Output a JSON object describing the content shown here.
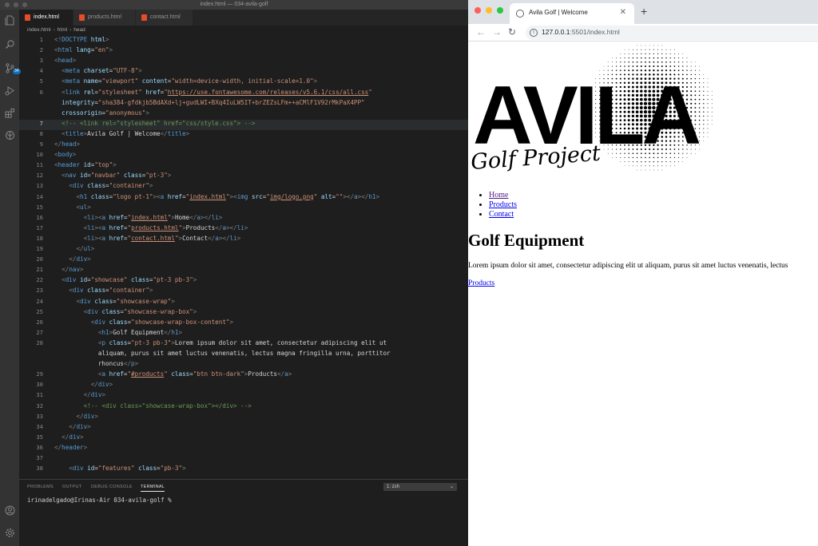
{
  "vscode": {
    "window_title": "index.html — 034-avila-golf",
    "activity_badge": "34",
    "tabs": [
      {
        "label": "index.html",
        "active": true
      },
      {
        "label": "products.html",
        "active": false
      },
      {
        "label": "contact.html",
        "active": false
      }
    ],
    "breadcrumb": [
      "index.html",
      "html",
      "head"
    ],
    "panel": {
      "tabs": [
        "PROBLEMS",
        "OUTPUT",
        "DEBUG CONSOLE",
        "TERMINAL"
      ],
      "active_tab": "TERMINAL",
      "shell": "1: zsh",
      "prompt": "irinadelgado@Irinas-Air 034-avila-golf %"
    },
    "cursor_line": "7"
  },
  "browser": {
    "tab_title": "Avila Golf | Welcome",
    "url_host": "127.0.0.1",
    "url_rest": ":5501/index.html",
    "page": {
      "logo_word": "AVILA",
      "logo_tagline": "Golf Project",
      "nav": [
        "Home",
        "Products",
        "Contact"
      ],
      "heading": "Golf Equipment",
      "paragraph": "Lorem ipsum dolor sit amet, consectetur adipiscing elit ut aliquam, purus sit amet luctus venenatis, lectus",
      "button": "Products"
    }
  },
  "code_lines": [
    {
      "n": "1",
      "t": [
        [
          "pu",
          "<!"
        ],
        [
          "tg",
          "DOCTYPE"
        ],
        [
          "at",
          " html"
        ],
        [
          "pu",
          ">"
        ]
      ]
    },
    {
      "n": "2",
      "t": [
        [
          "pu",
          "<"
        ],
        [
          "tg",
          "html"
        ],
        [
          "at",
          " lang"
        ],
        [
          "tx",
          "="
        ],
        [
          "st",
          "\"en\""
        ],
        [
          "pu",
          ">"
        ]
      ]
    },
    {
      "n": "3",
      "t": [
        [
          "pu",
          "<"
        ],
        [
          "tg",
          "head"
        ],
        [
          "pu",
          ">"
        ]
      ]
    },
    {
      "n": "4",
      "t": [
        [
          "tx",
          "  "
        ],
        [
          "pu",
          "<"
        ],
        [
          "tg",
          "meta"
        ],
        [
          "at",
          " charset"
        ],
        [
          "tx",
          "="
        ],
        [
          "st",
          "\"UTF-8\""
        ],
        [
          "pu",
          ">"
        ]
      ]
    },
    {
      "n": "5",
      "t": [
        [
          "tx",
          "  "
        ],
        [
          "pu",
          "<"
        ],
        [
          "tg",
          "meta"
        ],
        [
          "at",
          " name"
        ],
        [
          "tx",
          "="
        ],
        [
          "st",
          "\"viewport\""
        ],
        [
          "at",
          " content"
        ],
        [
          "tx",
          "="
        ],
        [
          "st",
          "\"width=device-width, initial-scale=1.0\""
        ],
        [
          "pu",
          ">"
        ]
      ]
    },
    {
      "n": "6",
      "t": [
        [
          "tx",
          "  "
        ],
        [
          "pu",
          "<"
        ],
        [
          "tg",
          "link"
        ],
        [
          "at",
          " rel"
        ],
        [
          "tx",
          "="
        ],
        [
          "st",
          "\"stylesheet\""
        ],
        [
          "at",
          " href"
        ],
        [
          "tx",
          "="
        ],
        [
          "st",
          "\""
        ],
        [
          "lk",
          "https://use.fontawesome.com/releases/v5.6.1/css/all.css"
        ],
        [
          "st",
          "\""
        ]
      ]
    },
    {
      "n": "",
      "t": [
        [
          "tx",
          "  "
        ],
        [
          "at",
          "integrity"
        ],
        [
          "tx",
          "="
        ],
        [
          "st",
          "\"sha384-gfdkjb5BdAXd+lj+gudLWI+BXq4IuLW5IT+brZEZsLFm++aCMlF1V92rMkPaX4PP\""
        ]
      ]
    },
    {
      "n": "",
      "t": [
        [
          "tx",
          "  "
        ],
        [
          "at",
          "crossorigin"
        ],
        [
          "tx",
          "="
        ],
        [
          "st",
          "\"anonymous\""
        ],
        [
          "pu",
          ">"
        ]
      ]
    },
    {
      "n": "7",
      "t": [
        [
          "tx",
          "  "
        ],
        [
          "cm",
          "<!-- <link rel=\"stylesheet\" href=\"css/style.css\"> -->"
        ]
      ]
    },
    {
      "n": "8",
      "t": [
        [
          "tx",
          "  "
        ],
        [
          "pu",
          "<"
        ],
        [
          "tg",
          "title"
        ],
        [
          "pu",
          ">"
        ],
        [
          "tx",
          "Avila Golf | Welcome"
        ],
        [
          "pu",
          "</"
        ],
        [
          "tg",
          "title"
        ],
        [
          "pu",
          ">"
        ]
      ]
    },
    {
      "n": "9",
      "t": [
        [
          "pu",
          "</"
        ],
        [
          "tg",
          "head"
        ],
        [
          "pu",
          ">"
        ]
      ]
    },
    {
      "n": "10",
      "t": [
        [
          "pu",
          "<"
        ],
        [
          "tg",
          "body"
        ],
        [
          "pu",
          ">"
        ]
      ]
    },
    {
      "n": "11",
      "t": [
        [
          "pu",
          "<"
        ],
        [
          "tg",
          "header"
        ],
        [
          "at",
          " id"
        ],
        [
          "tx",
          "="
        ],
        [
          "st",
          "\"top\""
        ],
        [
          "pu",
          ">"
        ]
      ]
    },
    {
      "n": "12",
      "t": [
        [
          "tx",
          "  "
        ],
        [
          "pu",
          "<"
        ],
        [
          "tg",
          "nav"
        ],
        [
          "at",
          " id"
        ],
        [
          "tx",
          "="
        ],
        [
          "st",
          "\"navbar\""
        ],
        [
          "at",
          " class"
        ],
        [
          "tx",
          "="
        ],
        [
          "st",
          "\"pt-3\""
        ],
        [
          "pu",
          ">"
        ]
      ]
    },
    {
      "n": "13",
      "t": [
        [
          "tx",
          "    "
        ],
        [
          "pu",
          "<"
        ],
        [
          "tg",
          "div"
        ],
        [
          "at",
          " class"
        ],
        [
          "tx",
          "="
        ],
        [
          "st",
          "\"container\""
        ],
        [
          "pu",
          ">"
        ]
      ]
    },
    {
      "n": "14",
      "t": [
        [
          "tx",
          "      "
        ],
        [
          "pu",
          "<"
        ],
        [
          "tg",
          "h1"
        ],
        [
          "at",
          " class"
        ],
        [
          "tx",
          "="
        ],
        [
          "st",
          "\"logo pt-1\""
        ],
        [
          "pu",
          "><"
        ],
        [
          "tg",
          "a"
        ],
        [
          "at",
          " href"
        ],
        [
          "tx",
          "="
        ],
        [
          "st",
          "\""
        ],
        [
          "lk",
          "index.html"
        ],
        [
          "st",
          "\""
        ],
        [
          "pu",
          "><"
        ],
        [
          "tg",
          "img"
        ],
        [
          "at",
          " src"
        ],
        [
          "tx",
          "="
        ],
        [
          "st",
          "\""
        ],
        [
          "lk",
          "img/logo.png"
        ],
        [
          "st",
          "\""
        ],
        [
          "at",
          " alt"
        ],
        [
          "tx",
          "="
        ],
        [
          "st",
          "\"\""
        ],
        [
          "pu",
          "></"
        ],
        [
          "tg",
          "a"
        ],
        [
          "pu",
          "></"
        ],
        [
          "tg",
          "h1"
        ],
        [
          "pu",
          ">"
        ]
      ]
    },
    {
      "n": "15",
      "t": [
        [
          "tx",
          "      "
        ],
        [
          "pu",
          "<"
        ],
        [
          "tg",
          "ul"
        ],
        [
          "pu",
          ">"
        ]
      ]
    },
    {
      "n": "16",
      "t": [
        [
          "tx",
          "        "
        ],
        [
          "pu",
          "<"
        ],
        [
          "tg",
          "li"
        ],
        [
          "pu",
          "><"
        ],
        [
          "tg",
          "a"
        ],
        [
          "at",
          " href"
        ],
        [
          "tx",
          "="
        ],
        [
          "st",
          "\""
        ],
        [
          "lk",
          "index.html"
        ],
        [
          "st",
          "\""
        ],
        [
          "pu",
          ">"
        ],
        [
          "tx",
          "Home"
        ],
        [
          "pu",
          "</"
        ],
        [
          "tg",
          "a"
        ],
        [
          "pu",
          "></"
        ],
        [
          "tg",
          "li"
        ],
        [
          "pu",
          ">"
        ]
      ]
    },
    {
      "n": "17",
      "t": [
        [
          "tx",
          "        "
        ],
        [
          "pu",
          "<"
        ],
        [
          "tg",
          "li"
        ],
        [
          "pu",
          "><"
        ],
        [
          "tg",
          "a"
        ],
        [
          "at",
          " href"
        ],
        [
          "tx",
          "="
        ],
        [
          "st",
          "\""
        ],
        [
          "lk",
          "products.html"
        ],
        [
          "st",
          "\""
        ],
        [
          "pu",
          ">"
        ],
        [
          "tx",
          "Products"
        ],
        [
          "pu",
          "</"
        ],
        [
          "tg",
          "a"
        ],
        [
          "pu",
          "></"
        ],
        [
          "tg",
          "li"
        ],
        [
          "pu",
          ">"
        ]
      ]
    },
    {
      "n": "18",
      "t": [
        [
          "tx",
          "        "
        ],
        [
          "pu",
          "<"
        ],
        [
          "tg",
          "li"
        ],
        [
          "pu",
          "><"
        ],
        [
          "tg",
          "a"
        ],
        [
          "at",
          " href"
        ],
        [
          "tx",
          "="
        ],
        [
          "st",
          "\""
        ],
        [
          "lk",
          "contact.html"
        ],
        [
          "st",
          "\""
        ],
        [
          "pu",
          ">"
        ],
        [
          "tx",
          "Contact"
        ],
        [
          "pu",
          "</"
        ],
        [
          "tg",
          "a"
        ],
        [
          "pu",
          "></"
        ],
        [
          "tg",
          "li"
        ],
        [
          "pu",
          ">"
        ]
      ]
    },
    {
      "n": "19",
      "t": [
        [
          "tx",
          "      "
        ],
        [
          "pu",
          "</"
        ],
        [
          "tg",
          "ul"
        ],
        [
          "pu",
          ">"
        ]
      ]
    },
    {
      "n": "20",
      "t": [
        [
          "tx",
          "    "
        ],
        [
          "pu",
          "</"
        ],
        [
          "tg",
          "div"
        ],
        [
          "pu",
          ">"
        ]
      ]
    },
    {
      "n": "21",
      "t": [
        [
          "tx",
          "  "
        ],
        [
          "pu",
          "</"
        ],
        [
          "tg",
          "nav"
        ],
        [
          "pu",
          ">"
        ]
      ]
    },
    {
      "n": "22",
      "t": [
        [
          "tx",
          "  "
        ],
        [
          "pu",
          "<"
        ],
        [
          "tg",
          "div"
        ],
        [
          "at",
          " id"
        ],
        [
          "tx",
          "="
        ],
        [
          "st",
          "\"showcase\""
        ],
        [
          "at",
          " class"
        ],
        [
          "tx",
          "="
        ],
        [
          "st",
          "\"pt-3 pb-3\""
        ],
        [
          "pu",
          ">"
        ]
      ]
    },
    {
      "n": "23",
      "t": [
        [
          "tx",
          "    "
        ],
        [
          "pu",
          "<"
        ],
        [
          "tg",
          "div"
        ],
        [
          "at",
          " class"
        ],
        [
          "tx",
          "="
        ],
        [
          "st",
          "\"container\""
        ],
        [
          "pu",
          ">"
        ]
      ]
    },
    {
      "n": "24",
      "t": [
        [
          "tx",
          "      "
        ],
        [
          "pu",
          "<"
        ],
        [
          "tg",
          "div"
        ],
        [
          "at",
          " class"
        ],
        [
          "tx",
          "="
        ],
        [
          "st",
          "\"showcase-wrap\""
        ],
        [
          "pu",
          ">"
        ]
      ]
    },
    {
      "n": "25",
      "t": [
        [
          "tx",
          "        "
        ],
        [
          "pu",
          "<"
        ],
        [
          "tg",
          "div"
        ],
        [
          "at",
          " class"
        ],
        [
          "tx",
          "="
        ],
        [
          "st",
          "\"showcase-wrap-box\""
        ],
        [
          "pu",
          ">"
        ]
      ]
    },
    {
      "n": "26",
      "t": [
        [
          "tx",
          "          "
        ],
        [
          "pu",
          "<"
        ],
        [
          "tg",
          "div"
        ],
        [
          "at",
          " class"
        ],
        [
          "tx",
          "="
        ],
        [
          "st",
          "\"showcase-wrap-box-content\""
        ],
        [
          "pu",
          ">"
        ]
      ]
    },
    {
      "n": "27",
      "t": [
        [
          "tx",
          "            "
        ],
        [
          "pu",
          "<"
        ],
        [
          "tg",
          "h1"
        ],
        [
          "pu",
          ">"
        ],
        [
          "tx",
          "Golf Equipment"
        ],
        [
          "pu",
          "</"
        ],
        [
          "tg",
          "h1"
        ],
        [
          "pu",
          ">"
        ]
      ]
    },
    {
      "n": "28",
      "t": [
        [
          "tx",
          "            "
        ],
        [
          "pu",
          "<"
        ],
        [
          "tg",
          "p"
        ],
        [
          "at",
          " class"
        ],
        [
          "tx",
          "="
        ],
        [
          "st",
          "\"pt-3 pb-3\""
        ],
        [
          "pu",
          ">"
        ],
        [
          "tx",
          "Lorem ipsum dolor sit amet, consectetur adipiscing elit ut"
        ]
      ]
    },
    {
      "n": "",
      "t": [
        [
          "tx",
          "            aliquam, purus sit amet luctus venenatis, lectus magna fringilla urna, porttitor"
        ]
      ]
    },
    {
      "n": "",
      "t": [
        [
          "tx",
          "            rhoncus"
        ],
        [
          "pu",
          "</"
        ],
        [
          "tg",
          "p"
        ],
        [
          "pu",
          ">"
        ]
      ]
    },
    {
      "n": "29",
      "t": [
        [
          "tx",
          "            "
        ],
        [
          "pu",
          "<"
        ],
        [
          "tg",
          "a"
        ],
        [
          "at",
          " href"
        ],
        [
          "tx",
          "="
        ],
        [
          "st",
          "\""
        ],
        [
          "lk",
          "#products"
        ],
        [
          "st",
          "\""
        ],
        [
          "at",
          " class"
        ],
        [
          "tx",
          "="
        ],
        [
          "st",
          "\"btn btn-dark\""
        ],
        [
          "pu",
          ">"
        ],
        [
          "tx",
          "Products"
        ],
        [
          "pu",
          "</"
        ],
        [
          "tg",
          "a"
        ],
        [
          "pu",
          ">"
        ]
      ]
    },
    {
      "n": "30",
      "t": [
        [
          "tx",
          "          "
        ],
        [
          "pu",
          "</"
        ],
        [
          "tg",
          "div"
        ],
        [
          "pu",
          ">"
        ]
      ]
    },
    {
      "n": "31",
      "t": [
        [
          "tx",
          "        "
        ],
        [
          "pu",
          "</"
        ],
        [
          "tg",
          "div"
        ],
        [
          "pu",
          ">"
        ]
      ]
    },
    {
      "n": "32",
      "t": [
        [
          "tx",
          "        "
        ],
        [
          "cm",
          "<!-- <div class=\"showcase-wrap-box\"></div> -->"
        ]
      ]
    },
    {
      "n": "33",
      "t": [
        [
          "tx",
          "      "
        ],
        [
          "pu",
          "</"
        ],
        [
          "tg",
          "div"
        ],
        [
          "pu",
          ">"
        ]
      ]
    },
    {
      "n": "34",
      "t": [
        [
          "tx",
          "    "
        ],
        [
          "pu",
          "</"
        ],
        [
          "tg",
          "div"
        ],
        [
          "pu",
          ">"
        ]
      ]
    },
    {
      "n": "35",
      "t": [
        [
          "tx",
          "  "
        ],
        [
          "pu",
          "</"
        ],
        [
          "tg",
          "div"
        ],
        [
          "pu",
          ">"
        ]
      ]
    },
    {
      "n": "36",
      "t": [
        [
          "pu",
          "</"
        ],
        [
          "tg",
          "header"
        ],
        [
          "pu",
          ">"
        ]
      ]
    },
    {
      "n": "37",
      "t": []
    },
    {
      "n": "38",
      "t": [
        [
          "tx",
          "    "
        ],
        [
          "pu",
          "<"
        ],
        [
          "tg",
          "div"
        ],
        [
          "at",
          " id"
        ],
        [
          "tx",
          "="
        ],
        [
          "st",
          "\"features\""
        ],
        [
          "at",
          " class"
        ],
        [
          "tx",
          "="
        ],
        [
          "st",
          "\"pb-3\""
        ],
        [
          "pu",
          ">"
        ]
      ]
    }
  ]
}
